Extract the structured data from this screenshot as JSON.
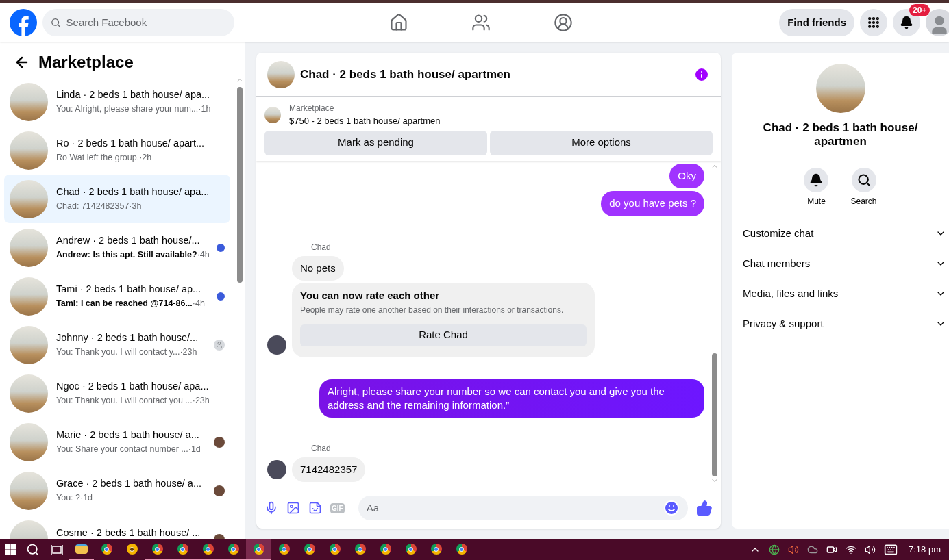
{
  "header": {
    "search": {
      "placeholder": "Search Facebook"
    },
    "nav": [
      {
        "kind": "home",
        "selected": false
      },
      {
        "kind": "friends",
        "selected": false
      },
      {
        "kind": "groups",
        "selected": false
      }
    ],
    "find_friends": "Find friends",
    "notifications_badge": "20+"
  },
  "sidebar": {
    "title": "Marketplace",
    "conversations": [
      {
        "kind": "plain",
        "title": "Linda · 2 beds 1 bath house/ apa...",
        "preview": "You: Alright, please share your num... ",
        "time": "·1h",
        "unread": false,
        "selected": false
      },
      {
        "kind": "plain",
        "title": "Ro · 2 beds 1 bath house/ apart...",
        "preview": "Ro Wat left the group.",
        "time": "·2h",
        "unread": false,
        "selected": false
      },
      {
        "kind": "plain",
        "title": "Chad · 2 beds 1 bath house/ apa...",
        "preview": "Chad: 7142482357",
        "time": "·3h",
        "unread": false,
        "selected": true
      },
      {
        "kind": "unread-dot",
        "title": "Andrew · 2 beds 1 bath house/...",
        "preview": "Andrew: Is this apt. Still available?",
        "time": "·4h",
        "unread": true,
        "selected": false
      },
      {
        "kind": "unread-dot",
        "title": "Tami · 2 beds 1 bath house/ ap...",
        "preview": "Tami: I can be reached @714-86... ",
        "time": "·4h",
        "unread": true,
        "selected": false
      },
      {
        "kind": "seen-default",
        "title": "Johnny · 2 beds 1 bath house/...",
        "preview": "You: Thank you. I will contact y... ",
        "time": "·23h",
        "unread": false,
        "selected": false
      },
      {
        "kind": "plain",
        "title": "Ngoc · 2 beds 1 bath house/ apa...",
        "preview": "You: Thank you. I will contact you ... ",
        "time": "·23h",
        "unread": false,
        "selected": false
      },
      {
        "kind": "seen-photo",
        "title": "Marie · 2 beds 1 bath house/ a...",
        "preview": "You: Share your contact number ...",
        "time": "·1d",
        "unread": false,
        "selected": false
      },
      {
        "kind": "seen-photo",
        "title": "Grace · 2 beds 1 bath house/ a...",
        "preview": "You: ?",
        "time": "·1d",
        "unread": false,
        "selected": false
      },
      {
        "kind": "seen-photo",
        "title": "Cosme · 2 beds 1 bath house/ ...",
        "selected": false
      }
    ]
  },
  "chat": {
    "title": "Chad · 2 beds 1 bath house/ apartmen",
    "listing": {
      "source": "Marketplace",
      "summary": "$750 - 2 beds 1 bath house/ apartmen",
      "buttons": [
        "Mark as pending",
        "More options"
      ]
    },
    "messages": [
      {
        "kind": "outgoing",
        "text": "Oky"
      },
      {
        "kind": "outgoing",
        "text": "do you have pets ?"
      },
      {
        "kind": "incoming",
        "sender": "Chad",
        "items": [
          {
            "kind": "text",
            "text": "No pets"
          },
          {
            "kind": "rating",
            "title": "You can now rate each other",
            "subtitle": "People may rate one another based on their interactions or transactions.",
            "button": "Rate Chad"
          }
        ]
      },
      {
        "kind": "outgoing-long",
        "text": "Alright, please share your number so we can contact you and give you the address and the remaining information.”"
      },
      {
        "kind": "incoming",
        "sender": "Chad",
        "items": [
          {
            "kind": "text",
            "text": "7142482357"
          }
        ]
      }
    ],
    "composer": {
      "placeholder": "Aa",
      "gif": "GIF"
    }
  },
  "details": {
    "title": "Chad · 2 beds 1 bath house/ apartmen",
    "actions": [
      {
        "kind": "mute",
        "label": "Mute"
      },
      {
        "kind": "search",
        "label": "Search"
      }
    ],
    "sections": [
      {
        "label": "Customize chat",
        "expanded": false
      },
      {
        "label": "Chat members",
        "expanded": false
      },
      {
        "label": "Media, files and links",
        "expanded": false
      },
      {
        "label": "Privacy & support",
        "expanded": false
      }
    ]
  },
  "taskbar": {
    "apps": [
      {
        "kind": "explorer",
        "running": true,
        "selected": false
      },
      {
        "kind": "chrome",
        "running": false,
        "selected": false
      },
      {
        "kind": "canary",
        "running": false,
        "selected": false
      },
      {
        "kind": "chrome",
        "running": true,
        "selected": false
      },
      {
        "kind": "chrome",
        "running": true,
        "selected": false
      },
      {
        "kind": "chrome",
        "running": true,
        "selected": false
      },
      {
        "kind": "chrome",
        "running": true,
        "selected": false
      },
      {
        "kind": "chrome",
        "running": true,
        "selected": true
      },
      {
        "kind": "chrome",
        "running": false,
        "selected": false
      },
      {
        "kind": "chrome",
        "running": false,
        "selected": false
      },
      {
        "kind": "chrome",
        "running": false,
        "selected": false
      },
      {
        "kind": "chrome",
        "running": false,
        "selected": false
      },
      {
        "kind": "chrome",
        "running": false,
        "selected": false
      },
      {
        "kind": "chrome",
        "running": false,
        "selected": false
      },
      {
        "kind": "chrome",
        "running": false,
        "selected": false
      },
      {
        "kind": "chrome",
        "running": false,
        "selected": false
      }
    ],
    "time": "7:18 pm"
  }
}
